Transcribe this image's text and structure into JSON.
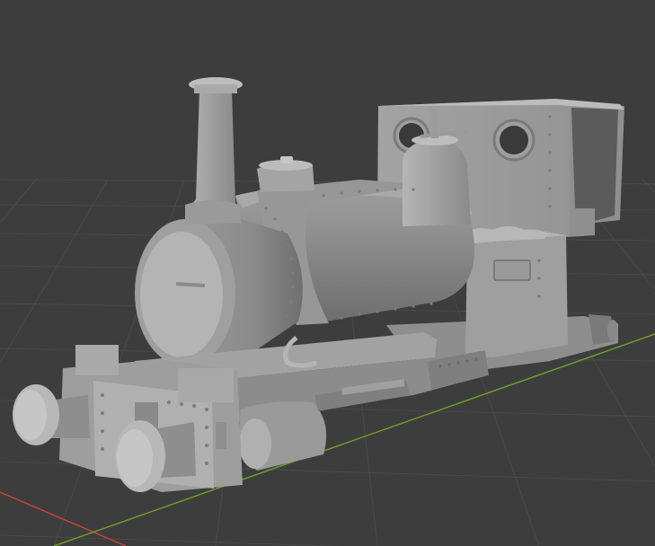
{
  "viewport": {
    "background": "#3d3d3d",
    "grid_color": "#4a4a4a",
    "x_axis_color": "#c2423c",
    "y_axis_color": "#6f9b2b"
  },
  "model": {
    "subject": "locomotive-icon",
    "base_color": "#a8a8a8",
    "shadow_color": "#6f6f6f",
    "highlight_color": "#c9c9c9"
  }
}
